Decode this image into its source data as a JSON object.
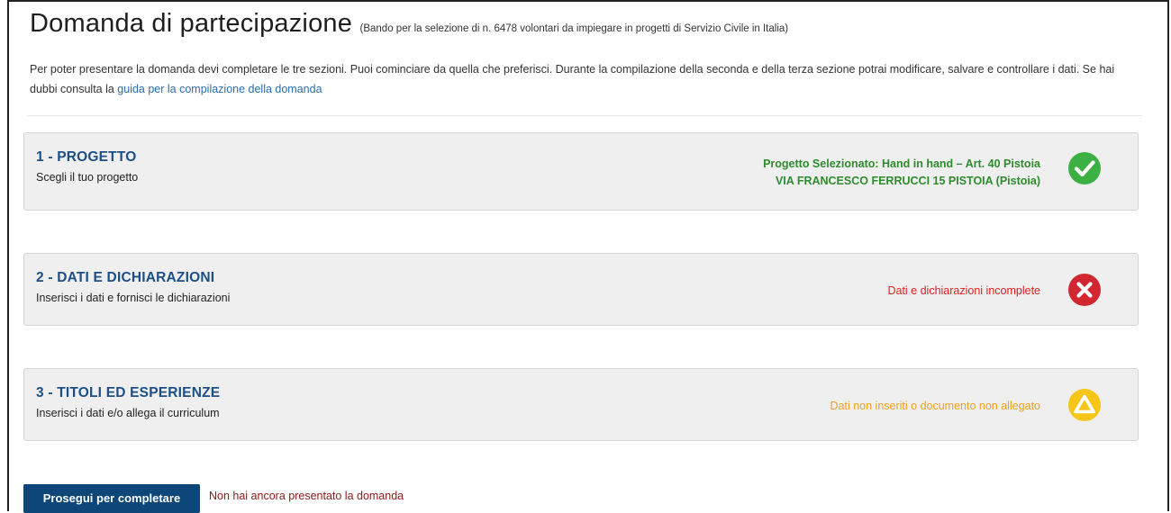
{
  "header": {
    "title": "Domanda di partecipazione",
    "subtitle": "(Bando per la selezione di n. 6478 volontari da impiegare in progetti di Servizio Civile in Italia)"
  },
  "intro": {
    "text": "Per poter presentare la domanda devi completare le tre sezioni. Puoi cominciare da quella che preferisci. Durante la compilazione della seconda e della terza sezione potrai modificare, salvare e controllare i dati. Se hai dubbi consulta la ",
    "link_label": "guida per la compilazione della domanda"
  },
  "sections": [
    {
      "title": "1 - PROGETTO",
      "description": "Scegli il tuo progetto",
      "status_line1": "Progetto Selezionato: Hand in hand – Art. 40 Pistoia",
      "status_line2": "VIA FRANCESCO FERRUCCI 15 PISTOIA (Pistoia)",
      "status_icon": "check-circle-icon",
      "status_color": "#3cb043"
    },
    {
      "title": "2 - DATI E DICHIARAZIONI",
      "description": "Inserisci i dati e fornisci le dichiarazioni",
      "status_line1": "Dati e dichiarazioni incomplete",
      "status_icon": "x-circle-icon",
      "status_color": "#d22730"
    },
    {
      "title": "3 - TITOLI ED ESPERIENZE",
      "description": "Inserisci i dati e/o allega il curriculum",
      "status_line1": "Dati non inseriti o documento non allegato",
      "status_icon": "warning-triangle-circle-icon",
      "status_color": "#f5c518"
    }
  ],
  "footer": {
    "button_label": "Prosegui per completare",
    "note": "Non hai ancora presentato la domanda"
  },
  "colors": {
    "primary": "#0d4679",
    "section_title": "#1c4f86",
    "link": "#2b6cb0",
    "note": "#8b1a1a"
  }
}
